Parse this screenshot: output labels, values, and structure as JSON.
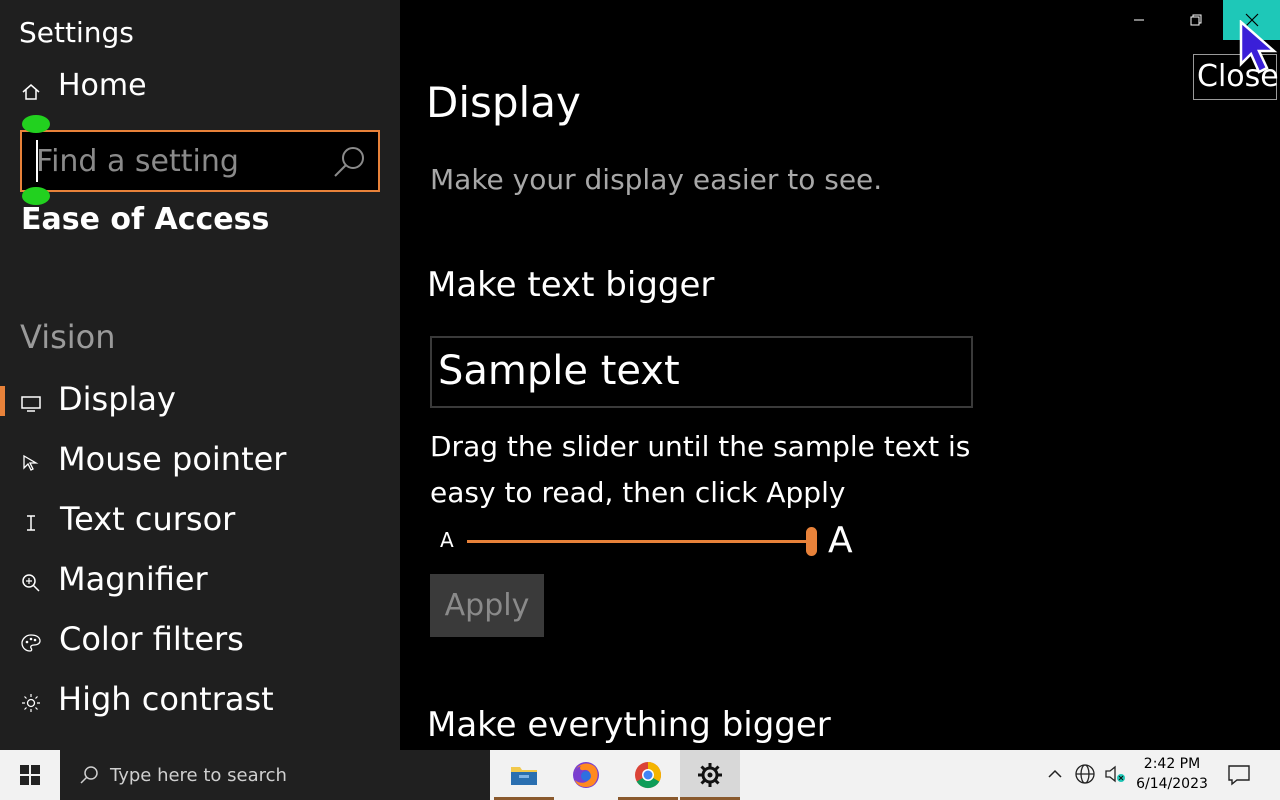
{
  "sidebar": {
    "app_title": "Settings",
    "home_label": "Home",
    "search_placeholder": "Find a setting",
    "section_title": "Ease of Access",
    "group_label": "Vision",
    "items": [
      {
        "label": "Display",
        "icon": "display-icon",
        "active": true
      },
      {
        "label": "Mouse pointer",
        "icon": "mouse-pointer-icon"
      },
      {
        "label": "Text cursor",
        "icon": "text-cursor-icon"
      },
      {
        "label": "Magnifier",
        "icon": "magnifier-icon"
      },
      {
        "label": "Color filters",
        "icon": "color-filters-icon"
      },
      {
        "label": "High contrast",
        "icon": "high-contrast-icon"
      }
    ]
  },
  "window": {
    "close_tooltip": "Close",
    "close_button_color": "#1ec8b8"
  },
  "main": {
    "title": "Display",
    "description": "Make your display easier to see.",
    "section1_title": "Make text bigger",
    "sample_text": "Sample text",
    "instructions": "Drag the slider until the sample text is easy to read, then click Apply",
    "slider": {
      "min_label": "A",
      "max_label": "A",
      "value_fraction": 1.0
    },
    "apply_label": "Apply",
    "section2_title": "Make everything bigger"
  },
  "taskbar": {
    "search_placeholder": "Type here to search",
    "apps": [
      "file-explorer-icon",
      "firefox-icon",
      "chrome-icon",
      "settings-gear-icon"
    ],
    "time": "2:42 PM",
    "date": "6/14/2023"
  },
  "colors": {
    "accent": "#e8823a",
    "sidebar_bg": "#1f1f1f",
    "main_bg": "#000000"
  }
}
